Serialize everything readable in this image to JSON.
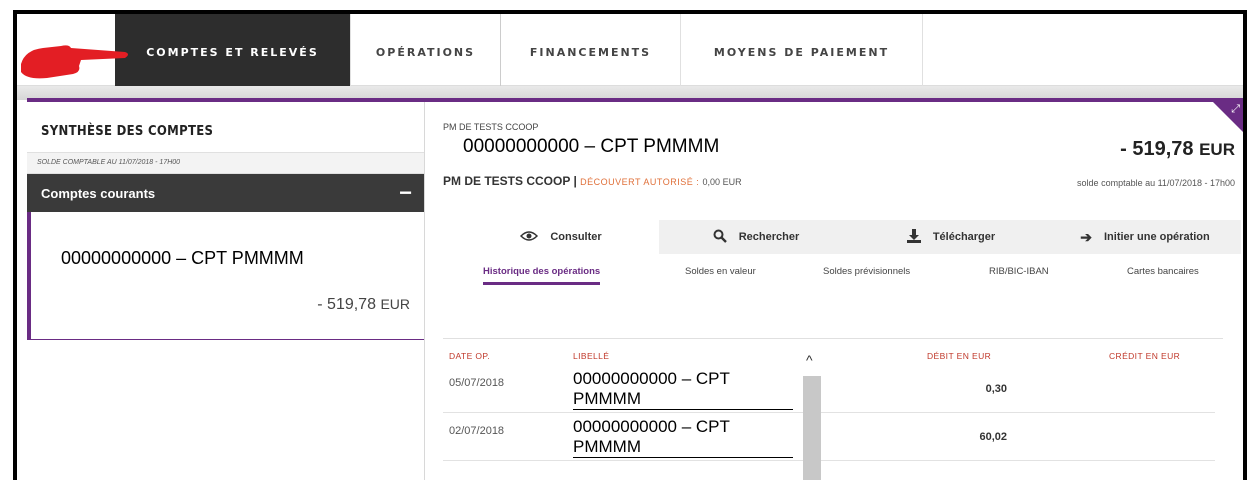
{
  "nav": {
    "items": [
      {
        "label": "COMPTES ET RELEVÉS",
        "active": true
      },
      {
        "label": "OPÉRATIONS",
        "active": false
      },
      {
        "label": "FINANCEMENTS",
        "active": false
      },
      {
        "label": "MOYENS DE PAIEMENT",
        "active": false
      }
    ]
  },
  "left": {
    "title": "SYNTHÈSE DES COMPTES",
    "subtitle": "SOLDE COMPTABLE AU 11/07/2018 - 17H00",
    "section_label": "Comptes courants",
    "collapse_symbol": "−",
    "account": {
      "name": "00000000000 – CPT PMMMM",
      "balance": "- 519,78",
      "currency": "EUR"
    }
  },
  "right": {
    "owner": "PM DE TESTS CCOOP",
    "account_name": "00000000000 – CPT PMMMM",
    "amount": "- 519,78",
    "currency": "EUR",
    "holder": "PM DE TESTS CCOOP |",
    "overdraft_label": "DÉCOUVERT AUTORISÉ :",
    "overdraft_value": "0,00 EUR",
    "balance_note": "solde comptable au 11/07/2018 - 17h00",
    "tabs": [
      {
        "label": "Consulter",
        "icon": "eye-icon",
        "active": true
      },
      {
        "label": "Rechercher",
        "icon": "search-icon",
        "active": false
      },
      {
        "label": "Télécharger",
        "icon": "download-icon",
        "active": false
      },
      {
        "label": "Initier une opération",
        "icon": "arrow-right-icon",
        "active": false
      }
    ],
    "subtabs": [
      {
        "label": "Historique des opérations",
        "active": true
      },
      {
        "label": "Soldes en valeur",
        "active": false
      },
      {
        "label": "Soldes prévisionnels",
        "active": false
      },
      {
        "label": "RIB/BIC-IBAN",
        "active": false
      },
      {
        "label": "Cartes bancaires",
        "active": false
      }
    ],
    "table": {
      "headers": {
        "date": "DATE OP.",
        "label": "LIBELLÉ",
        "debit": "DÉBIT EN EUR",
        "credit": "CRÉDIT EN EUR"
      },
      "rows": [
        {
          "date": "05/07/2018",
          "label_line1": "00000000000 – CPT",
          "label_line2": "PMMMM",
          "debit": "0,30",
          "credit": ""
        },
        {
          "date": "02/07/2018",
          "label_line1": "00000000000 – CPT",
          "label_line2": "PMMMM",
          "debit": "60,02",
          "credit": ""
        }
      ]
    }
  },
  "colors": {
    "brand_purple": "#6a2c84",
    "nav_active_bg": "#2d2d2d",
    "header_red": "#c0392b",
    "overdraft_orange": "#e0703a",
    "pointer_red": "#e31e24"
  }
}
